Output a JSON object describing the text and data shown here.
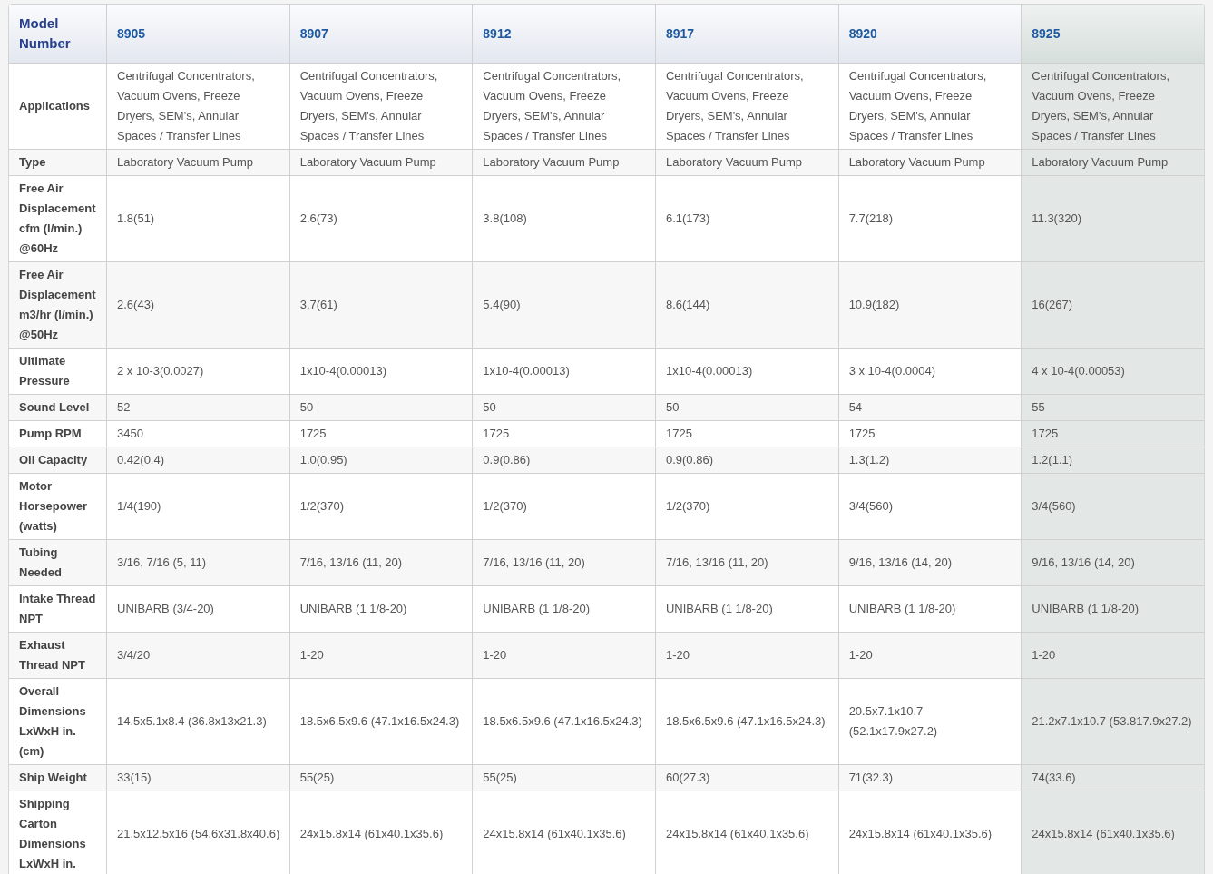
{
  "table": {
    "corner_header": "Model Number",
    "columns": [
      {
        "model": "8905",
        "highlighted": false
      },
      {
        "model": "8907",
        "highlighted": false
      },
      {
        "model": "8912",
        "highlighted": false
      },
      {
        "model": "8917",
        "highlighted": false
      },
      {
        "model": "8920",
        "highlighted": false
      },
      {
        "model": "8925",
        "highlighted": true
      }
    ],
    "rows": [
      {
        "label": "Applications",
        "values": [
          "Centrifugal Concentrators, Vacuum Ovens, Freeze Dryers, SEM's, Annular Spaces / Transfer Lines",
          "Centrifugal Concentrators, Vacuum Ovens, Freeze Dryers, SEM's, Annular Spaces / Transfer Lines",
          "Centrifugal Concentrators, Vacuum Ovens, Freeze Dryers, SEM's, Annular Spaces / Transfer Lines",
          "Centrifugal Concentrators, Vacuum Ovens, Freeze Dryers, SEM's, Annular Spaces / Transfer Lines",
          "Centrifugal Concentrators, Vacuum Ovens, Freeze Dryers, SEM's, Annular Spaces / Transfer Lines",
          "Centrifugal Concentrators, Vacuum Ovens, Freeze Dryers, SEM's, Annular Spaces / Transfer Lines"
        ]
      },
      {
        "label": "Type",
        "values": [
          "Laboratory Vacuum Pump",
          "Laboratory Vacuum Pump",
          "Laboratory Vacuum Pump",
          "Laboratory Vacuum Pump",
          "Laboratory Vacuum Pump",
          "Laboratory Vacuum Pump"
        ]
      },
      {
        "label": "Free Air Displacement cfm (l/min.) @60Hz",
        "values": [
          "1.8(51)",
          "2.6(73)",
          "3.8(108)",
          "6.1(173)",
          "7.7(218)",
          "11.3(320)"
        ]
      },
      {
        "label": "Free Air Displacement m3/hr (l/min.) @50Hz",
        "values": [
          "2.6(43)",
          "3.7(61)",
          "5.4(90)",
          "8.6(144)",
          "10.9(182)",
          "16(267)"
        ]
      },
      {
        "label": "Ultimate Pressure",
        "values": [
          "2 x 10-3(0.0027)",
          "1x10-4(0.00013)",
          "1x10-4(0.00013)",
          "1x10-4(0.00013)",
          "3 x 10-4(0.0004)",
          "4 x 10-4(0.00053)"
        ]
      },
      {
        "label": "Sound Level",
        "values": [
          "52",
          "50",
          "50",
          "50",
          "54",
          "55"
        ]
      },
      {
        "label": "Pump RPM",
        "values": [
          "3450",
          "1725",
          "1725",
          "1725",
          "1725",
          "1725"
        ]
      },
      {
        "label": "Oil Capacity",
        "values": [
          "0.42(0.4)",
          "1.0(0.95)",
          "0.9(0.86)",
          "0.9(0.86)",
          "1.3(1.2)",
          "1.2(1.1)"
        ]
      },
      {
        "label": "Motor Horsepower (watts)",
        "values": [
          "1/4(190)",
          "1/2(370)",
          "1/2(370)",
          "1/2(370)",
          "3/4(560)",
          "3/4(560)"
        ]
      },
      {
        "label": "Tubing Needed",
        "values": [
          "3/16, 7/16 (5, 11)",
          "7/16, 13/16 (11, 20)",
          "7/16, 13/16 (11, 20)",
          "7/16, 13/16 (11, 20)",
          "9/16, 13/16 (14, 20)",
          "9/16, 13/16 (14, 20)"
        ]
      },
      {
        "label": "Intake Thread NPT",
        "values": [
          "UNIBARB (3/4-20)",
          "UNIBARB (1 1/8-20)",
          "UNIBARB (1 1/8-20)",
          "UNIBARB (1 1/8-20)",
          "UNIBARB (1 1/8-20)",
          "UNIBARB (1 1/8-20)"
        ]
      },
      {
        "label": "Exhaust Thread NPT",
        "values": [
          "3/4/20",
          "1-20",
          "1-20",
          "1-20",
          "1-20",
          "1-20"
        ]
      },
      {
        "label": "Overall Dimensions LxWxH in. (cm)",
        "values": [
          "14.5x5.1x8.4 (36.8x13x21.3)",
          "18.5x6.5x9.6 (47.1x16.5x24.3)",
          "18.5x6.5x9.6 (47.1x16.5x24.3)",
          "18.5x6.5x9.6 (47.1x16.5x24.3)",
          "20.5x7.1x10.7 (52.1x17.9x27.2)",
          "21.2x7.1x10.7 (53.817.9x27.2)"
        ]
      },
      {
        "label": "Ship Weight",
        "values": [
          "33(15)",
          "55(25)",
          "55(25)",
          "60(27.3)",
          "71(32.3)",
          "74(33.6)"
        ]
      },
      {
        "label": "Shipping Carton Dimensions LxWxH in.",
        "values": [
          "21.5x12.5x16 (54.6x31.8x40.6)",
          "24x15.8x14 (61x40.1x35.6)",
          "24x15.8x14 (61x40.1x35.6)",
          "24x15.8x14 (61x40.1x35.6)",
          "24x15.8x14 (61x40.1x35.6)",
          "24x15.8x14 (61x40.1x35.6)"
        ]
      }
    ]
  }
}
